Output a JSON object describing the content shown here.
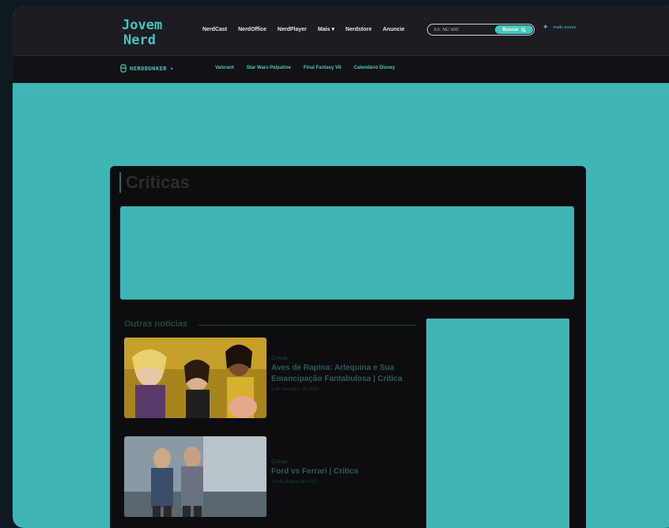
{
  "header": {
    "logo_text": "Jovem Nerd",
    "nav": [
      "NerdCast",
      "NerdOffice",
      "NerdPlayer",
      "Mais ▾",
      "Nerdstore",
      "Anuncie"
    ],
    "search_placeholder": "Ex: NC 500",
    "search_button": "Buscar",
    "dark_mode_label": "modo escuro"
  },
  "subheader": {
    "brand": "NERDBUNKER",
    "links": [
      "Valorant",
      "Star Wars Palpatine",
      "Final Fantasy VII",
      "Calendário Disney"
    ]
  },
  "main": {
    "title": "Críticas",
    "section_label": "Outras notícias",
    "news": [
      {
        "category": "Críticas",
        "title": "Aves de Rapina: Arlequina e Sua Emancipação Fantabulosa | Crítica",
        "date": "5 de fevereiro de 2020"
      },
      {
        "category": "Críticas",
        "title": "Ford vs Ferrari | Crítica",
        "date": "14 de janeiro de 2020"
      }
    ]
  },
  "colors": {
    "accent": "#3ec8c4",
    "overlay": "#3fb5b5",
    "header_bg": "#1c1c22",
    "panel_bg": "#0d0d10"
  }
}
